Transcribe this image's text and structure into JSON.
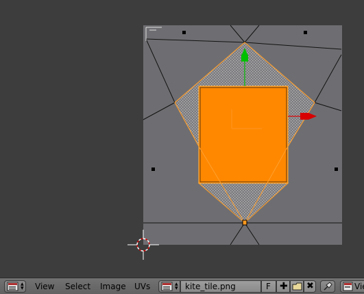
{
  "header": {
    "menus": [
      "View",
      "Select",
      "Image",
      "UVs"
    ],
    "image_name": "kite_tile.png",
    "fake_user_label": "F",
    "view_label": "Vie"
  },
  "icons": {
    "editor_type": "image-editor-icon",
    "image_browse": "image-browse-icon",
    "new_image": "plus-icon",
    "open_image": "folder-icon",
    "unlink_image": "close-icon",
    "pin": "pin-icon",
    "view_mode": "image-editor-icon"
  },
  "colors": {
    "background": "#3d3d3d",
    "image_gray": "#6e6e72",
    "selected_face": "#ff8800",
    "selected_edge": "#ff9a1f",
    "x_axis": "#d80000",
    "y_axis": "#00c000"
  }
}
